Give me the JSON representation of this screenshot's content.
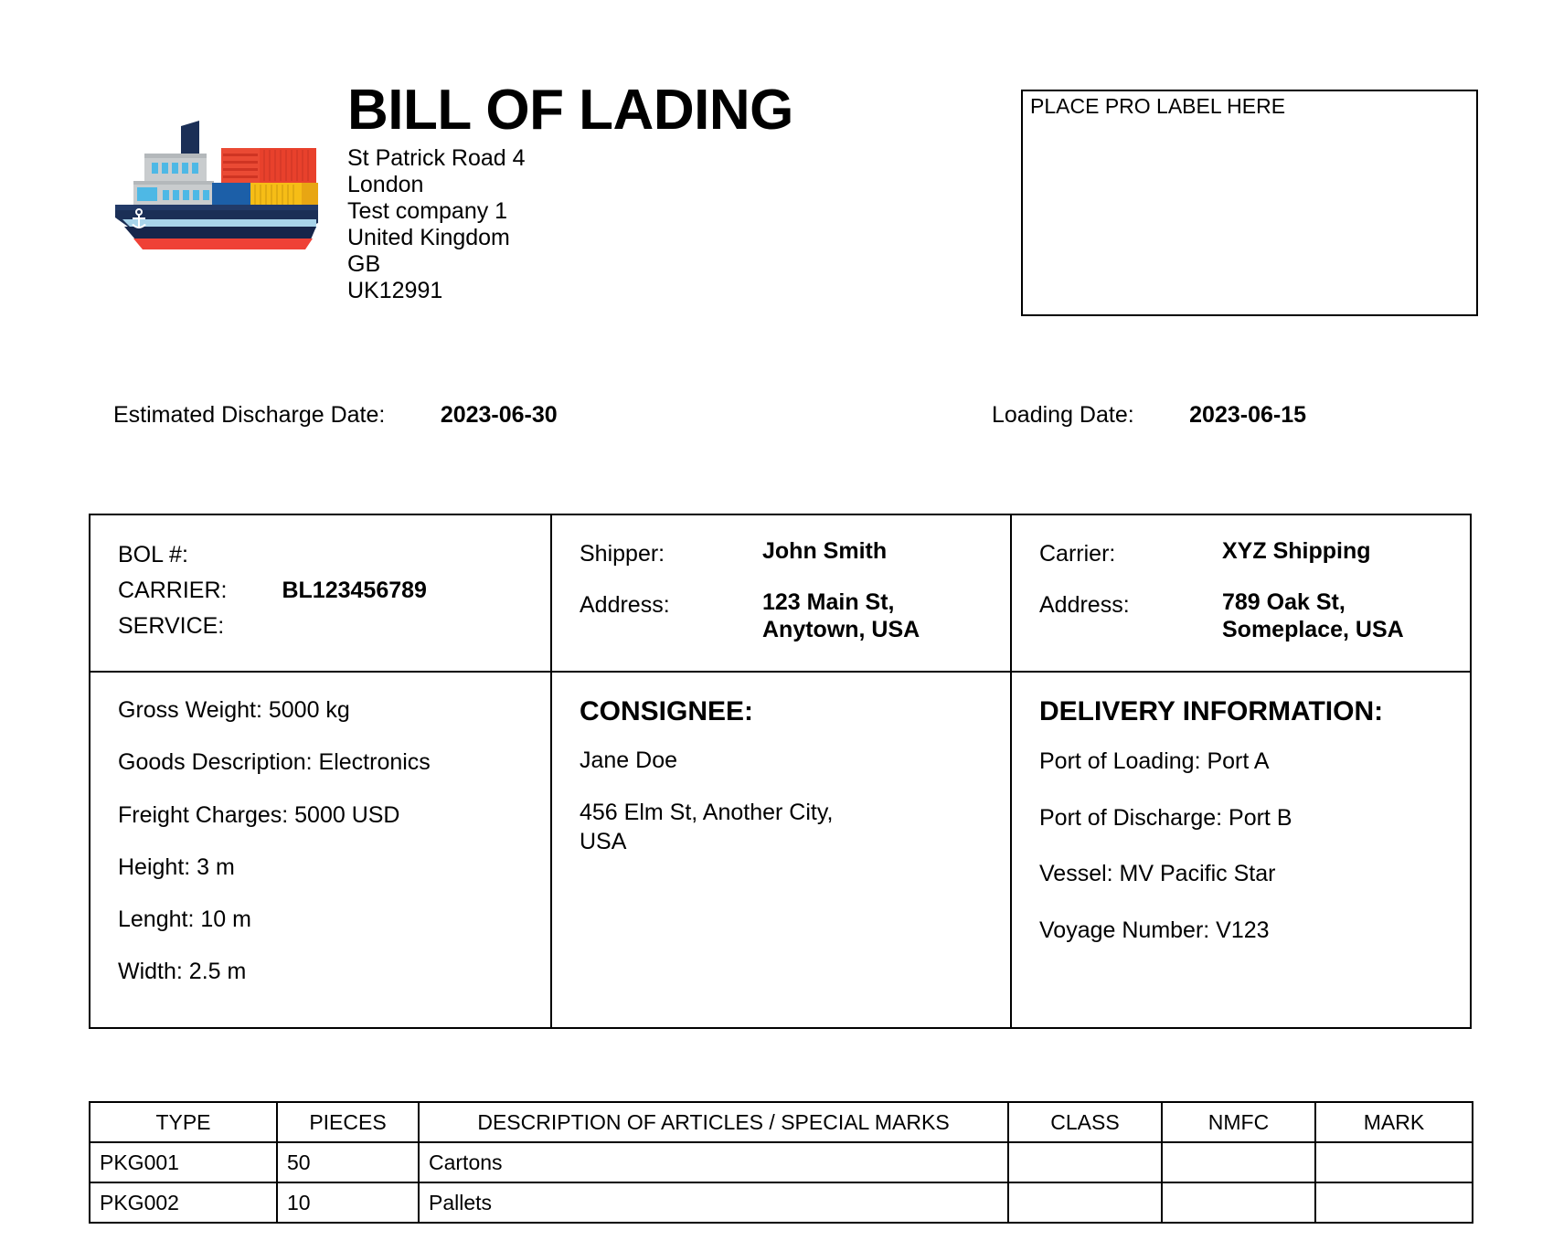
{
  "header": {
    "title": "BILL OF LADING",
    "logo_icon": "container-ship-icon",
    "address_lines": [
      "St Patrick Road 4",
      "London",
      "Test company 1",
      "United Kingdom",
      "GB",
      "UK12991"
    ]
  },
  "pro_label": {
    "text": "PLACE PRO LABEL HERE"
  },
  "dates": {
    "discharge_label": "Estimated Discharge Date:",
    "discharge_value": "2023-06-30",
    "loading_label": "Loading Date:",
    "loading_value": "2023-06-15"
  },
  "bol": {
    "label_bol": "BOL #:",
    "label_carrier": "CARRIER:",
    "label_service": "SERVICE:",
    "value_bol_number": "BL123456789"
  },
  "shipper": {
    "label_name": "Shipper:",
    "label_address": "Address:",
    "name": "John Smith",
    "address_line1": "123 Main St,",
    "address_line2": "Anytown, USA"
  },
  "carrier": {
    "label_name": "Carrier:",
    "label_address": "Address:",
    "name": "XYZ Shipping",
    "address_line1": "789 Oak St,",
    "address_line2": "Someplace, USA"
  },
  "cargo": {
    "gross_weight": "Gross Weight: 5000 kg",
    "goods_description": "Goods Description: Electronics",
    "freight_charges": "Freight Charges: 5000 USD",
    "height": "Height: 3 m",
    "length": "Lenght: 10 m",
    "width": "Width: 2.5 m"
  },
  "consignee": {
    "heading": "CONSIGNEE:",
    "name": "Jane Doe",
    "address_line1": "456 Elm St, Another City,",
    "address_line2": "USA"
  },
  "delivery": {
    "heading": "DELIVERY INFORMATION:",
    "port_of_loading": "Port of Loading: Port A",
    "port_of_discharge": "Port of Discharge: Port B",
    "vessel": "Vessel: MV Pacific Star",
    "voyage_number": "Voyage Number: V123"
  },
  "articles_table": {
    "headers": [
      "TYPE",
      "PIECES",
      "DESCRIPTION OF ARTICLES / SPECIAL MARKS",
      "CLASS",
      "NMFC",
      "MARK"
    ],
    "rows": [
      {
        "type": "PKG001",
        "pieces": "50",
        "description": "Cartons",
        "class": "",
        "nmfc": "",
        "mark": ""
      },
      {
        "type": "PKG002",
        "pieces": "10",
        "description": "Pallets",
        "class": "",
        "nmfc": "",
        "mark": ""
      }
    ]
  },
  "colors": {
    "hull_navy": "#1b2f56",
    "hull_dark": "#16254a",
    "hull_stripe_light": "#a8d4ea",
    "hull_red": "#ef4136",
    "container_red": "#ea4a34",
    "container_blue": "#1c5fa8",
    "container_yellow": "#f6bd16",
    "superstructure_gray": "#c9ccce",
    "window_blue": "#4eb8e5",
    "text_black": "#000000"
  }
}
